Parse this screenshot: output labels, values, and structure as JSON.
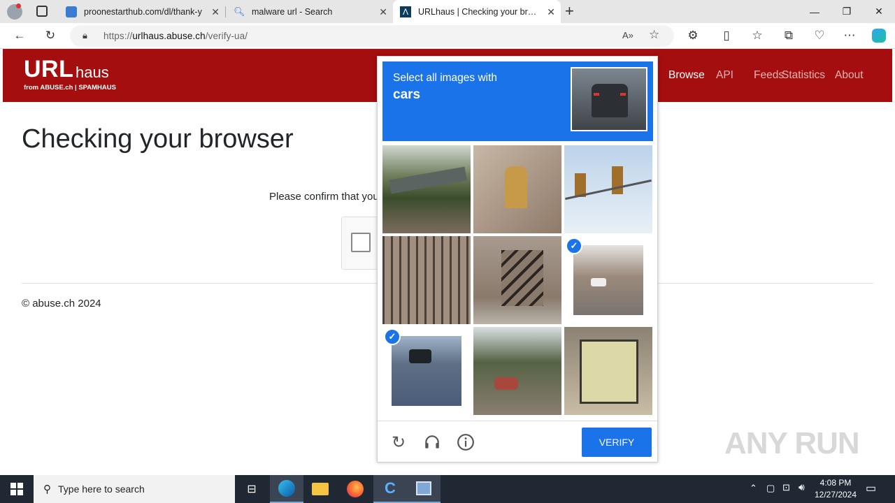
{
  "browser": {
    "tabs": [
      {
        "title": "proonestarthub.com/dl/thank-y",
        "active": false
      },
      {
        "title": "malware url - Search",
        "active": false
      },
      {
        "title": "URLhaus | Checking your browser",
        "active": true
      }
    ],
    "new_tab_label": "+",
    "url_prefix": "https://",
    "url_host": "urlhaus.abuse.ch",
    "url_path": "/verify-ua/"
  },
  "site": {
    "logo": "URL",
    "logo_suffix": "haus",
    "logo_sub": "from ABUSE.ch | SPAMHAUS",
    "nav": [
      "Browse",
      "API",
      "Feeds",
      "Statistics",
      "About"
    ],
    "active_nav": "Browse",
    "heading": "Checking your browser",
    "confirm_text": "Please confirm that you",
    "footer": "© abuse.ch 2024"
  },
  "captcha": {
    "prompt": "Select all images with",
    "target": "cars",
    "tiles": [
      {
        "subject": "overpass-sign",
        "selected": false
      },
      {
        "subject": "fire-hydrant",
        "selected": false
      },
      {
        "subject": "traffic-lights",
        "selected": false
      },
      {
        "subject": "bridge-railing",
        "selected": false
      },
      {
        "subject": "stairs",
        "selected": false
      },
      {
        "subject": "street-cars",
        "selected": true
      },
      {
        "subject": "road-cars",
        "selected": true
      },
      {
        "subject": "street-red-car",
        "selected": false
      },
      {
        "subject": "bus",
        "selected": false
      }
    ],
    "verify_label": "VERIFY",
    "accent": "#1a73e8"
  },
  "watermark": "ANY RUN",
  "taskbar": {
    "search_placeholder": "Type here to search",
    "time": "4:08 PM",
    "date": "12/27/2024"
  }
}
